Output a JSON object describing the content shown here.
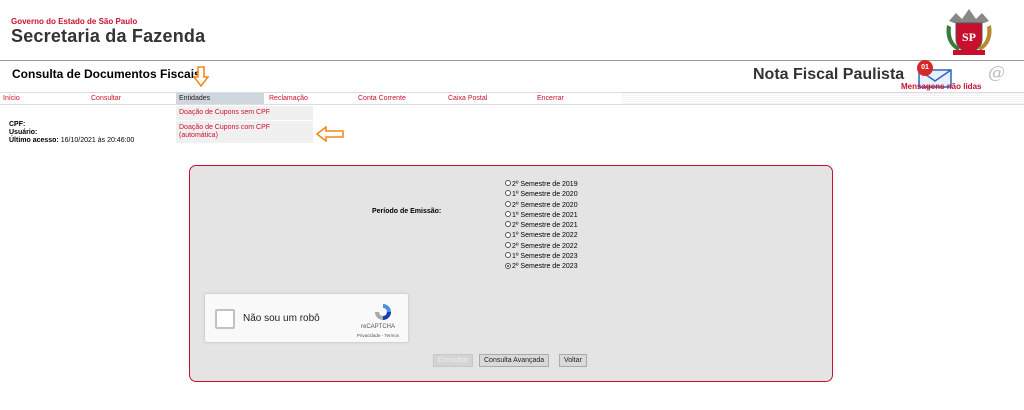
{
  "header": {
    "gov_label": "Governo do Estado de São Paulo",
    "title": "Secretaria da Fazenda",
    "crest_initials": "SP",
    "page_title": "Consulta de Documentos Fiscais",
    "brand": "Nota Fiscal Paulista",
    "messages_badge": "01",
    "messages_label": "Mensagens não lidas",
    "accent_color": "#c8102e"
  },
  "menu": {
    "items": [
      {
        "label": "Início"
      },
      {
        "label": "Consultar"
      },
      {
        "label": "Entidades"
      },
      {
        "label": "Reclamação"
      },
      {
        "label": "Conta Corrente"
      },
      {
        "label": "Caixa Postal"
      },
      {
        "label": "Encerrar"
      }
    ],
    "active": "Entidades",
    "submenu": [
      {
        "label": "Doação de Cupons sem CPF"
      },
      {
        "label": "Doação de Cupons com CPF (automática)"
      }
    ]
  },
  "user": {
    "cpf_label": "CPF:",
    "usuario_label": "Usuário:",
    "last_access_label": "Último acesso:",
    "last_access_value": "16/10/2021 às 20:46:00"
  },
  "form": {
    "period_label": "Período de Emissão:",
    "periods": [
      "2º Semestre de 2019",
      "1º Semestre de 2020",
      "2º Semestre de 2020",
      "1º Semestre de 2021",
      "2º Semestre de 2021",
      "1º Semestre de 2022",
      "2º Semestre de 2022",
      "1º Semestre de 2023",
      "2º Semestre de 2023"
    ],
    "selected_period": "2º Semestre de 2023"
  },
  "captcha": {
    "label": "Não sou um robô",
    "brand": "reCAPTCHA",
    "terms": "Privacidade - Termos"
  },
  "buttons": {
    "consultar": "Consultar",
    "consulta_avancada": "Consulta Avançada",
    "voltar": "Voltar"
  }
}
